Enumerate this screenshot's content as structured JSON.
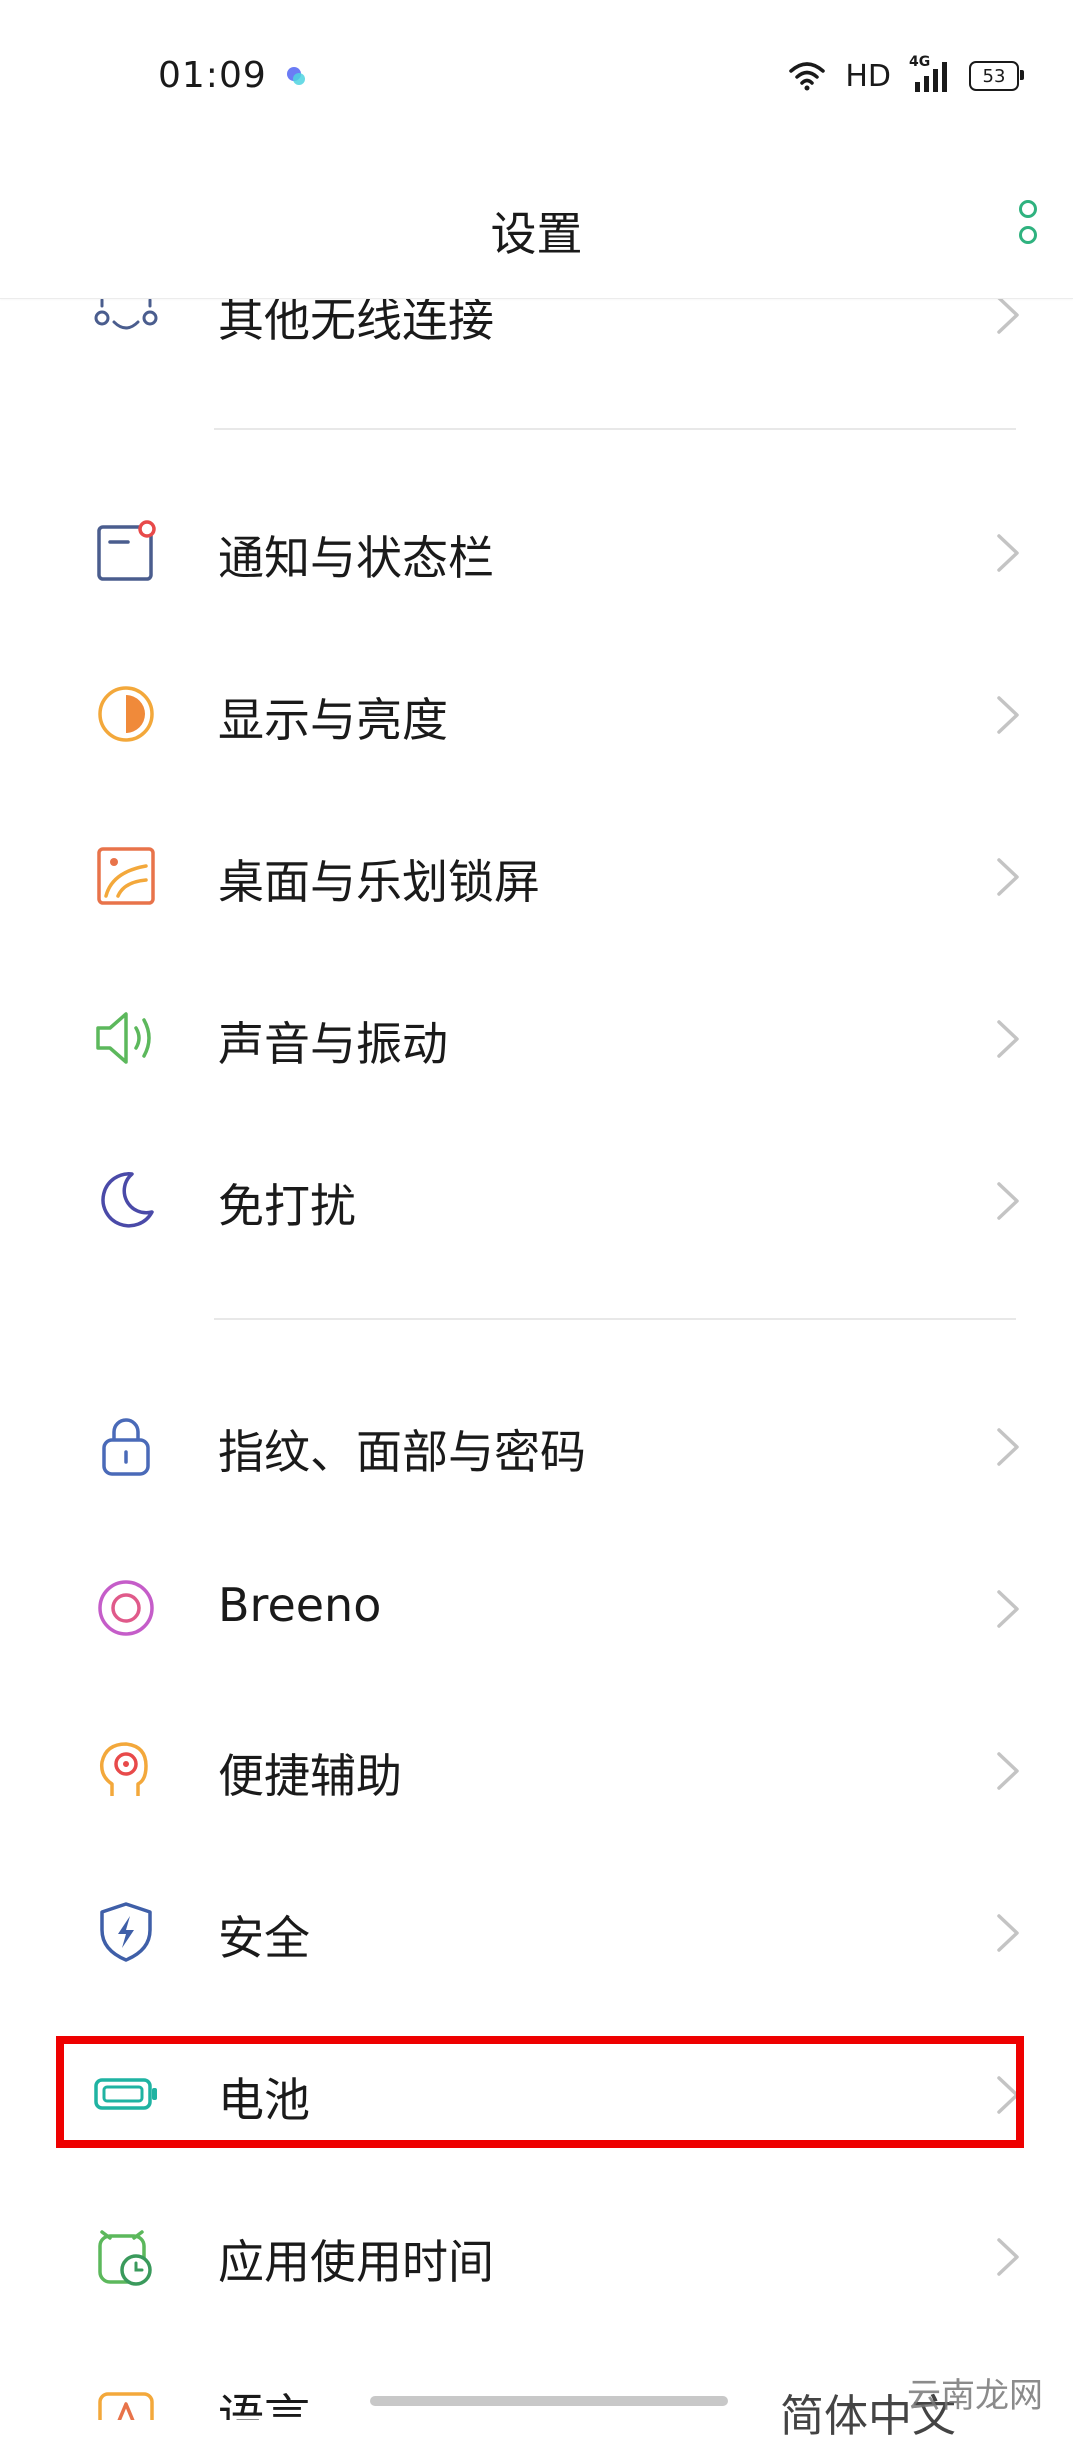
{
  "status": {
    "time": "01:09",
    "network": "HD",
    "signal": "4G",
    "battery": "53"
  },
  "appbar": {
    "title": "设置"
  },
  "items": [
    {
      "label": "其他无线连接",
      "icon": "wireless-icon"
    },
    {
      "label": "通知与状态栏",
      "icon": "notification-icon"
    },
    {
      "label": "显示与亮度",
      "icon": "brightness-icon"
    },
    {
      "label": "桌面与乐划锁屏",
      "icon": "wallpaper-icon"
    },
    {
      "label": "声音与振动",
      "icon": "sound-icon"
    },
    {
      "label": "免打扰",
      "icon": "moon-icon"
    },
    {
      "label": "指纹、面部与密码",
      "icon": "lock-icon"
    },
    {
      "label": "Breeno",
      "icon": "breeno-icon"
    },
    {
      "label": "便捷辅助",
      "icon": "assist-icon"
    },
    {
      "label": "安全",
      "icon": "shield-icon"
    },
    {
      "label": "电池",
      "icon": "battery-icon"
    },
    {
      "label": "应用使用时间",
      "icon": "app-timer-icon"
    },
    {
      "label": "语言",
      "icon": "language-icon"
    }
  ],
  "partial_value": "简体中文",
  "watermark": "云南龙网",
  "colors": {
    "accent": "#2fb27f",
    "highlight": "#ee0000"
  }
}
